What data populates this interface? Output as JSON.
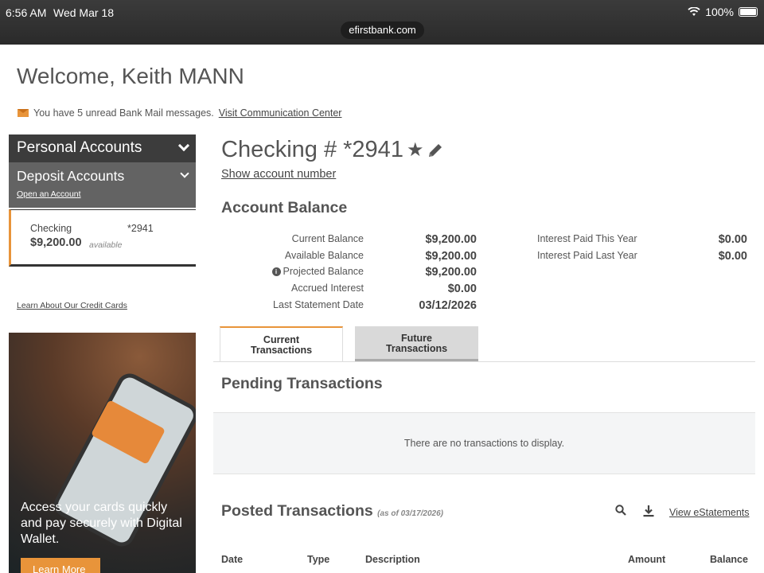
{
  "status_bar": {
    "time": "6:56 AM",
    "date": "Wed Mar 18",
    "battery": "100%"
  },
  "browser": {
    "url": "efirstbank.com"
  },
  "header": {
    "welcome": "Welcome, Keith MANN",
    "mail_message": "You have 5 unread Bank Mail messages.",
    "mail_link": "Visit Communication Center"
  },
  "sidebar": {
    "personal_accounts": "Personal Accounts",
    "deposit_accounts": "Deposit Accounts",
    "open_account": "Open an Account",
    "account": {
      "name": "Checking",
      "number": "*2941",
      "amount": "$9,200.00",
      "available": "available"
    },
    "credit_link": "Learn About Our Credit Cards"
  },
  "promo": {
    "text": "Access your cards quickly and pay securely with Digital Wallet.",
    "button": "Learn More"
  },
  "account": {
    "title": "Checking # *2941",
    "show_number": "Show account number",
    "balance_title": "Account Balance",
    "balances": [
      {
        "label": "Current Balance",
        "value": "$9,200.00"
      },
      {
        "label": "Available Balance",
        "value": "$9,200.00"
      },
      {
        "label": "Projected Balance",
        "value": "$9,200.00"
      },
      {
        "label": "Accrued Interest",
        "value": "$0.00"
      },
      {
        "label": "Last Statement Date",
        "value": "03/12/2026"
      }
    ],
    "interest": [
      {
        "label": "Interest Paid This Year",
        "value": "$0.00"
      },
      {
        "label": "Interest Paid Last Year",
        "value": "$0.00"
      }
    ]
  },
  "tabs": {
    "current_line1": "Current",
    "current_line2": "Transactions",
    "future_line1": "Future",
    "future_line2": "Transactions"
  },
  "pending": {
    "title": "Pending Transactions",
    "empty": "There are no transactions to display."
  },
  "posted": {
    "title": "Posted Transactions",
    "as_of": "(as of 03/17/2026)",
    "estatements": "View eStatements",
    "columns": [
      "Date",
      "Type",
      "Description",
      "Amount",
      "Balance"
    ]
  },
  "colors": {
    "accent": "#e8943a",
    "dark_header": "#3c3c3c"
  }
}
